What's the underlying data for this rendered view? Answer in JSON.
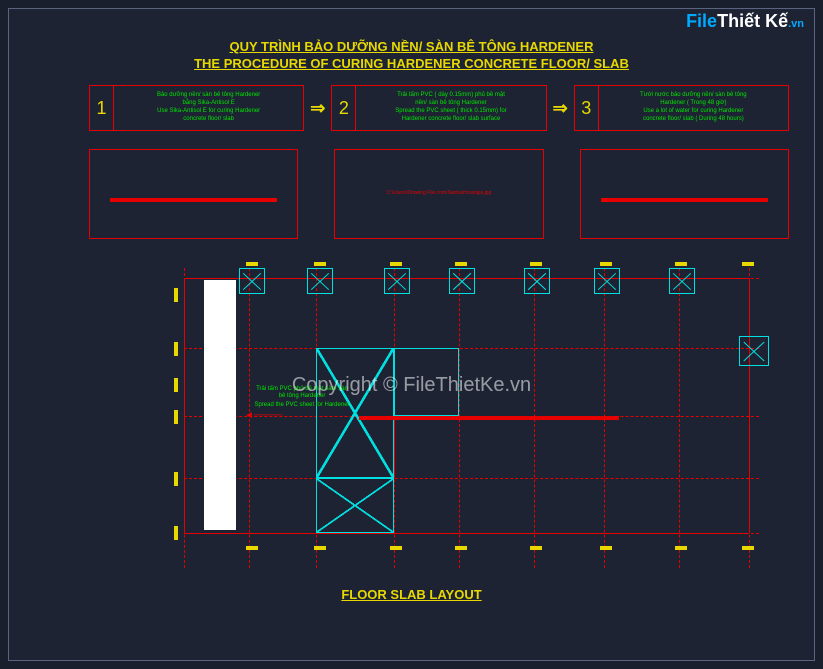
{
  "logo": {
    "part1": "File",
    "part2": "Thiết Kế",
    "suffix": ".vn"
  },
  "title": {
    "vi": "QUY TRÌNH BẢO DƯỠNG NỀN/ SÀN BÊ TÔNG HARDENER",
    "en": "THE PROCEDURE OF CURING HARDENER CONCRETE FLOOR/ SLAB"
  },
  "steps": [
    {
      "num": "1",
      "vi1": "Bảo dưỡng nền/ sàn bê tông Hardener",
      "vi2": "bằng Sika-Antisol E",
      "en1": "Use Sika-Antisol E for curing Hardener",
      "en2": "concrete floor/ slab"
    },
    {
      "num": "2",
      "vi1": "Trải tấm PVC ( dày 0.15mm) phủ bề mặt",
      "vi2": "nền/ sàn bê tông Hardener",
      "en1": "Spread the PVC sheet ( thick 0.15mm) for",
      "en2": "Hardener concrete floor/ slab surface"
    },
    {
      "num": "3",
      "vi1": "Tưới nước bảo dưỡng nền/ sàn bê tông",
      "vi2": "Hardener ( Trong 48 giờ)",
      "en1": "Use a lot of water for curing Hardener",
      "en2": "concrete floor/ slab ( During 48 hours)"
    }
  ],
  "panels": [
    {
      "type": "bar"
    },
    {
      "type": "text",
      "text": "C:\\Users\\Drawing File.com\\Sanbuichoangia.jpg"
    },
    {
      "type": "bar"
    }
  ],
  "plan_notes": {
    "vi": "Trải tấm PVC phủ bề mặt sàn/ sàn bê tông Hardener",
    "en": "Spread the PVC sheet for Hardener"
  },
  "layout_label": "FLOOR SLAB LAYOUT",
  "copyright": "Copyright © FileThietKe.vn"
}
